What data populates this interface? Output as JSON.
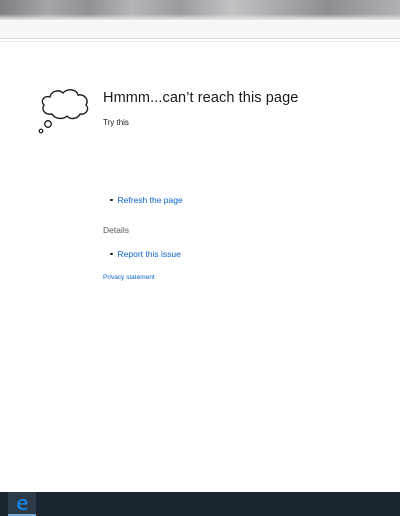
{
  "error_page": {
    "title": "Hmmm...can’t reach this page",
    "subtitle": "Try this",
    "suggestions": [
      {
        "label": "Refresh the page"
      }
    ],
    "details_heading": "Details",
    "details_links": [
      {
        "label": "Report this issue"
      }
    ],
    "privacy_link": "Privacy statement",
    "icon": "thought-cloud-icon"
  },
  "taskbar": {
    "pinned_apps": [
      {
        "name": "Microsoft Edge",
        "icon": "edge-icon",
        "active": true
      }
    ],
    "colors": {
      "background": "#1b2530",
      "active_tile": "#2c3947",
      "edge_blue": "#1a7fd6"
    }
  },
  "colors": {
    "link": "#0b63ce",
    "text": "#1b1b1b",
    "muted": "#5a5a5a"
  }
}
